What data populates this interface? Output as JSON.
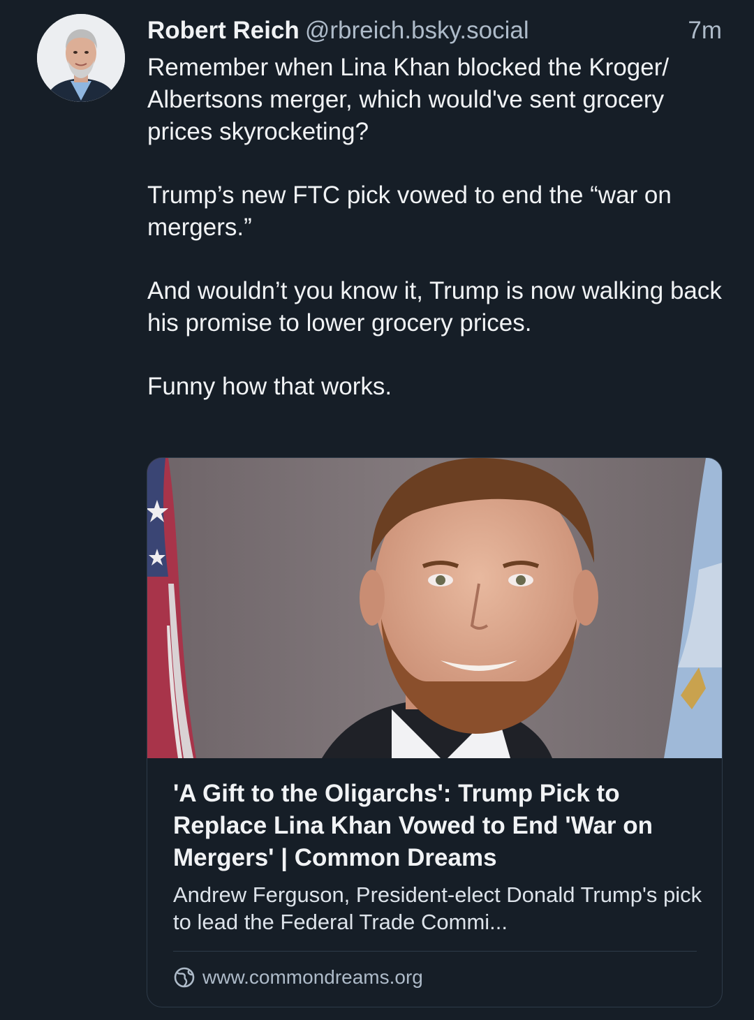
{
  "post": {
    "author_name": "Robert Reich",
    "author_handle": "@rbreich.bsky.social",
    "timestamp": "7m",
    "paragraphs": [
      "Remember when Lina Khan blocked the Kroger/ Albertsons merger, which would've sent grocery prices skyrocketing?",
      "Trump’s new FTC pick vowed to end the “war on mergers.”",
      "And wouldn’t you know it, Trump is now walking back his promise to lower grocery prices.",
      "Funny how that works."
    ]
  },
  "link_card": {
    "title": "'A Gift to the Oligarchs': Trump Pick to Replace Lina Khan Vowed to End 'War on Mergers' | Common Dreams",
    "description": "Andrew Ferguson, President-elect Donald Trump's pick to lead the Federal Trade Commi...",
    "domain": "www.commondreams.org",
    "domain_icon": "globe-icon"
  },
  "colors": {
    "background": "#161e27",
    "text_primary": "#f1f3f5",
    "text_secondary": "#aebbc9",
    "card_border": "#2e3b49"
  }
}
